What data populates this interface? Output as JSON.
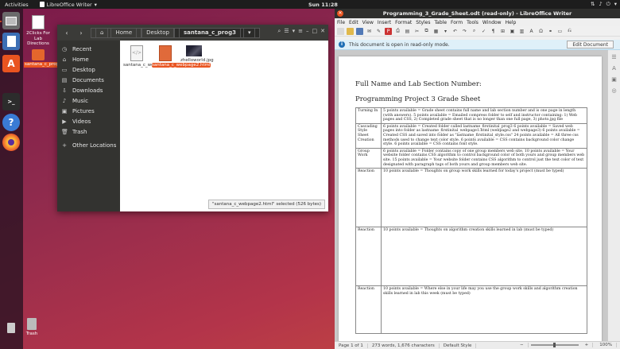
{
  "topbar": {
    "activities": "Activities",
    "app_name": "LibreOffice Writer",
    "clock": "Sun 11:28"
  },
  "desktop": {
    "icons": [
      {
        "label": "2Clicks For Lab Directions"
      },
      {
        "label": "santana_c_prog3"
      },
      {
        "label": "Trash"
      }
    ]
  },
  "file_manager": {
    "breadcrumb": {
      "home": "Home",
      "desktop": "Desktop",
      "current": "santana_c_prog3"
    },
    "sidebar": [
      {
        "label": "Recent",
        "icon": "clock-icon"
      },
      {
        "label": "Home",
        "icon": "home-icon"
      },
      {
        "label": "Desktop",
        "icon": "desktop-icon"
      },
      {
        "label": "Documents",
        "icon": "documents-icon"
      },
      {
        "label": "Downloads",
        "icon": "downloads-icon"
      },
      {
        "label": "Music",
        "icon": "music-icon"
      },
      {
        "label": "Pictures",
        "icon": "pictures-icon"
      },
      {
        "label": "Videos",
        "icon": "videos-icon"
      },
      {
        "label": "Trash",
        "icon": "trash-icon"
      },
      {
        "label": "Other Locations",
        "icon": "plus-icon"
      }
    ],
    "files": [
      {
        "name": "santana_c_webpage1.html",
        "selected": false
      },
      {
        "name": "santana_c_webpage2.html",
        "selected": true
      },
      {
        "name": "zhelloworld.jpg",
        "selected": false
      }
    ],
    "status": "\"santana_c_webpage2.html\" selected  (526 bytes)"
  },
  "writer": {
    "title": "Programming_3_Grade_Sheet.odt (read-only) - LibreOffice Writer",
    "menu": [
      "File",
      "Edit",
      "View",
      "Insert",
      "Format",
      "Styles",
      "Table",
      "Form",
      "Tools",
      "Window",
      "Help"
    ],
    "info_bar": "This document is open in read-only mode.",
    "edit_button": "Edit Document",
    "doc": {
      "heading1": "Full Name and Lab Section Number:",
      "heading2": "Programming Project 3 Grade Sheet",
      "rows": [
        {
          "label": "Turning In",
          "text": "5 points available = Grade sheet contains full name and lab section number and is one page in length (with answers). 5 points available = Emailed compress folder to self and instructor containing: 1) Web pages and CSS, 2) Completed grade sheet that is no longer than one full page, 3) photo.jpg file"
        },
        {
          "label": "Cascading Style Sheet Creation",
          "text": "6 points available = Created folder called lastname_firstinital_prog3 6 points available = Saved web pages into folder as lastname_firstinital_webpage1.html (webpage2 and webpage3) 6 points available = Created CSS and saved into folder as \"lastname_firstinital_style.css\" 24 points available = All three css methods used to change text color style. 6 points available = CSS contains background color change style. 6 points available = CSS contains font style."
        },
        {
          "label": "Group Work",
          "text": "6 points available = Folder contains copy of one group members web site. 10 points available = Your website folder contains CSS algorithm to control background color of both yours and group members web site. 15 points available = Your website folder contains CSS algorithm to control just the text color of text designated with paragraph tags of both yours and group members web site."
        },
        {
          "label": "Reaction",
          "text": "10 points available = Thoughts on group work skills learned for today's project (must be typed)"
        },
        {
          "label": "Reaction",
          "text": "10 points available = Thoughts on algorithm creation skills learned in lab (must be typed)"
        },
        {
          "label": "Reaction",
          "text": "10 points available = Where else in your life may you use the group work skills and algorithm creation skills learned in lab this week (must be typed)"
        }
      ]
    },
    "statusbar": {
      "page": "Page 1 of 1",
      "words": "273 words, 1,676 characters",
      "style": "Default Style",
      "zoom": "100%"
    }
  }
}
